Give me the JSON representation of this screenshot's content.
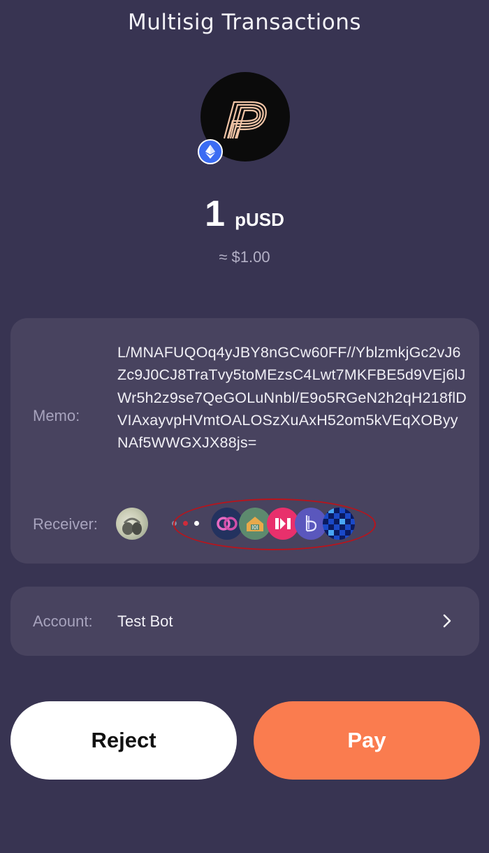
{
  "header": {
    "title": "Multisig Transactions"
  },
  "asset": {
    "logo_icon": "pusd-logo-icon",
    "chain_icon": "ethereum-icon",
    "amount": "1",
    "symbol": "pUSD",
    "fiat_value": "≈ $1.00"
  },
  "details": {
    "memo_label": "Memo:",
    "memo_value": "L/MNAFUQOq4yJBY8nGCw60FF//YblzmkjGc2vJ6Zc9J0CJ8TraTvy5toMEzsC4Lwt7MKFBE5d9VEj6lJWr5h2z9se7QeGOLuNnbl/E9o5RGeN2h2qH218flDVIAxayvpHVmtOALOSzXuAxH52om5kVEqXOByyNAf5WWGXJX88js=",
    "receiver_label": "Receiver:",
    "receivers": [
      {
        "icon": "user-avatar-photo"
      },
      {
        "icon": "sync-link-icon",
        "color": "#23325f"
      },
      {
        "icon": "house-icon",
        "color": "#5d8a6e"
      },
      {
        "icon": "brackets-icon",
        "color": "#e8306c"
      },
      {
        "icon": "b-logo-icon",
        "color": "#5a57bd"
      },
      {
        "icon": "checker-icon",
        "color": "#1a49c8"
      }
    ],
    "highlight_color": "#b8141c"
  },
  "account": {
    "label": "Account:",
    "value": "Test Bot"
  },
  "actions": {
    "reject_label": "Reject",
    "pay_label": "Pay",
    "pay_color": "#fa7c4f"
  }
}
